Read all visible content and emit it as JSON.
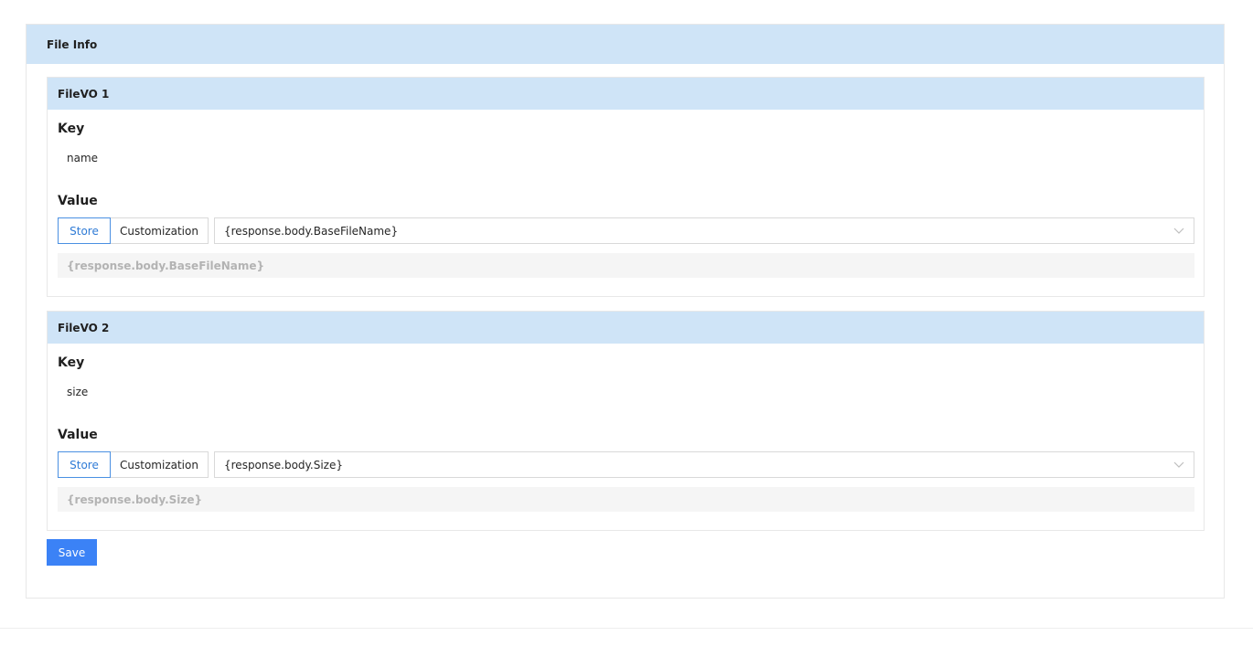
{
  "panel": {
    "title": "File Info"
  },
  "files": [
    {
      "title": "FileVO 1",
      "key_label": "Key",
      "key_value": "name",
      "value_label": "Value",
      "store_label": "Store",
      "custom_label": "Customization",
      "selected": "{response.body.BaseFileName}",
      "preview": "{response.body.BaseFileName}"
    },
    {
      "title": "FileVO 2",
      "key_label": "Key",
      "key_value": "size",
      "value_label": "Value",
      "store_label": "Store",
      "custom_label": "Customization",
      "selected": "{response.body.Size}",
      "preview": "{response.body.Size}"
    }
  ],
  "actions": {
    "save_label": "Save"
  },
  "colors": {
    "header_bg": "#cfe4f7",
    "accent": "#3b82f6",
    "selected_border": "#4a90e2"
  },
  "icons": {
    "select_chevron": "chevron-down-icon"
  }
}
